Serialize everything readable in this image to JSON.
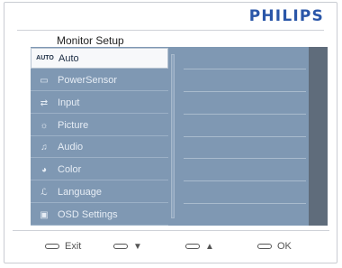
{
  "brand": "PHILIPS",
  "title": "Monitor Setup",
  "menu": [
    {
      "icon": "AUTO",
      "icon_name": "auto-icon",
      "label": "Auto"
    },
    {
      "icon": "▭",
      "icon_name": "powersensor-icon",
      "label": "PowerSensor"
    },
    {
      "icon": "⇄",
      "icon_name": "input-icon",
      "label": "Input"
    },
    {
      "icon": "☼",
      "icon_name": "picture-icon",
      "label": "Picture"
    },
    {
      "icon": "♫",
      "icon_name": "audio-icon",
      "label": "Audio"
    },
    {
      "icon": "◕",
      "icon_name": "color-icon",
      "label": "Color"
    },
    {
      "icon": "ℒ",
      "icon_name": "language-icon",
      "label": "Language"
    },
    {
      "icon": "▣",
      "icon_name": "osd-settings-icon",
      "label": "OSD Settings"
    }
  ],
  "footer": {
    "exit": "Exit",
    "down": "▼",
    "up": "▲",
    "ok": "OK"
  }
}
